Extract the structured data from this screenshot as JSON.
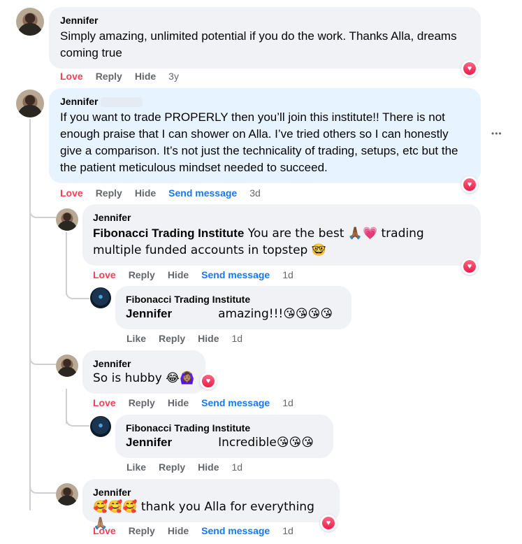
{
  "comments": [
    {
      "author": "Jennifer",
      "text": "Simply amazing, unlimited potential if you do the work. Thanks Alla, dreams coming true",
      "actions": {
        "love": "Love",
        "reply": "Reply",
        "hide": "Hide",
        "time": "3y"
      }
    },
    {
      "author": "Jennifer",
      "text": "If you want to trade PROPERLY then you’ll join this institute!! There is not enough praise that I can shower on Alla. I’ve tried others so I can honestly give a comparison. It’s not just the technicality of trading, setups, etc but the the patient meticulous mindset needed to succeed.",
      "actions": {
        "love": "Love",
        "reply": "Reply",
        "hide": "Hide",
        "send": "Send message",
        "time": "3d"
      },
      "more": "•••"
    }
  ],
  "replies": [
    {
      "author": "Jennifer",
      "tag": "Fibonacci Trading Institute",
      "text": " You are the best 🙏🏾💗 trading multiple funded accounts in topstep 🤓",
      "actions": {
        "love": "Love",
        "reply": "Reply",
        "hide": "Hide",
        "send": "Send message",
        "time": "1d"
      }
    },
    {
      "author": "Fibonacci Trading Institute",
      "tag": "Jennifer",
      "text": "amazing!!!😘😘😘😘",
      "actions": {
        "like": "Like",
        "reply": "Reply",
        "hide": "Hide",
        "time": "1d"
      }
    },
    {
      "author": "Jennifer",
      "text": "So is hubby 😂🙆🏽‍♀️",
      "actions": {
        "love": "Love",
        "reply": "Reply",
        "hide": "Hide",
        "send": "Send message",
        "time": "1d"
      }
    },
    {
      "author": "Fibonacci Trading Institute",
      "tag": "Jennifer",
      "text": "Incredible😘😘😘",
      "actions": {
        "like": "Like",
        "reply": "Reply",
        "hide": "Hide",
        "time": "1d"
      }
    },
    {
      "author": "Jennifer",
      "text": "🥰🥰🥰 thank you Alla for everything 🙏🏽",
      "actions": {
        "love": "Love",
        "reply": "Reply",
        "hide": "Hide",
        "send": "Send message",
        "time": "1d"
      }
    }
  ],
  "icons": {
    "reaction": "heart-icon",
    "more": "more-options-icon",
    "accent_love": "#f33e58",
    "accent_link": "#1877f2"
  }
}
